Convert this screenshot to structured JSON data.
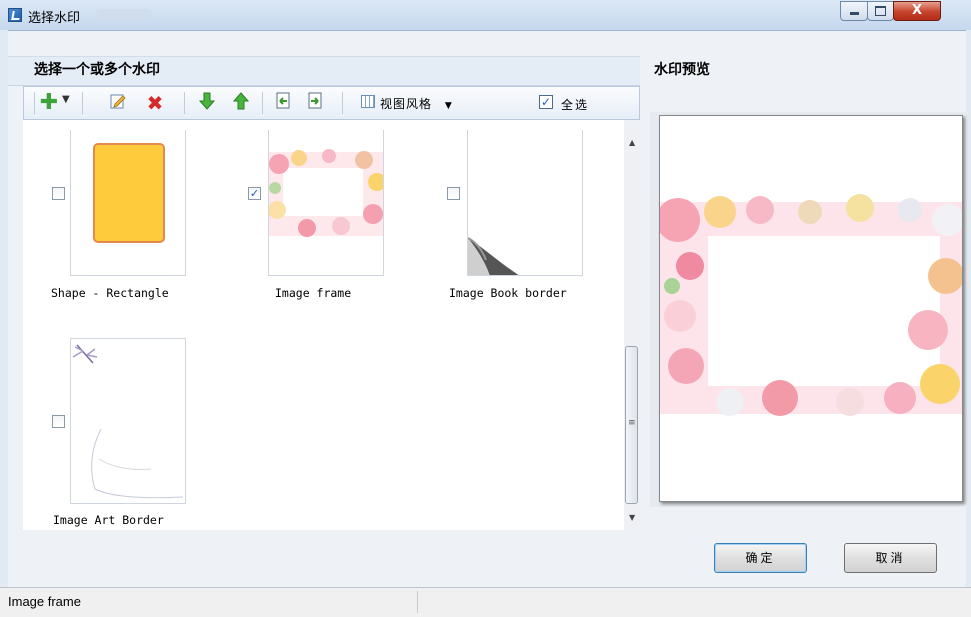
{
  "window": {
    "title": "选择水印",
    "controls": {
      "minimize": "",
      "maximize": "",
      "close": "X"
    }
  },
  "left_panel": {
    "heading": "选择一个或多个水印",
    "toolbar": {
      "icons": [
        "add-icon",
        "dropdown-arrow",
        "edit-icon",
        "delete-icon",
        "move-down-icon",
        "move-up-icon",
        "import-icon",
        "export-icon",
        "view-style-icon"
      ],
      "view_style_label": "视图风格",
      "select_all_label": "全选",
      "select_all_checked": true
    },
    "items": [
      {
        "caption": "Shape - Rectangle",
        "checked": false
      },
      {
        "caption": "Image frame",
        "checked": true
      },
      {
        "caption": "Image Book border",
        "checked": false
      },
      {
        "caption": "Image Art Border",
        "checked": false
      }
    ]
  },
  "right_panel": {
    "heading": "水印预览"
  },
  "buttons": {
    "ok": "确定",
    "cancel": "取消"
  },
  "status_bar": {
    "text": "Image frame"
  },
  "colors": {
    "rectangle_fill": "#FDCB3C",
    "rectangle_border": "#E58A4E",
    "accent_blue": "#3C7FB1",
    "add_green": "#3CA33A",
    "delete_red": "#D52A2A"
  }
}
